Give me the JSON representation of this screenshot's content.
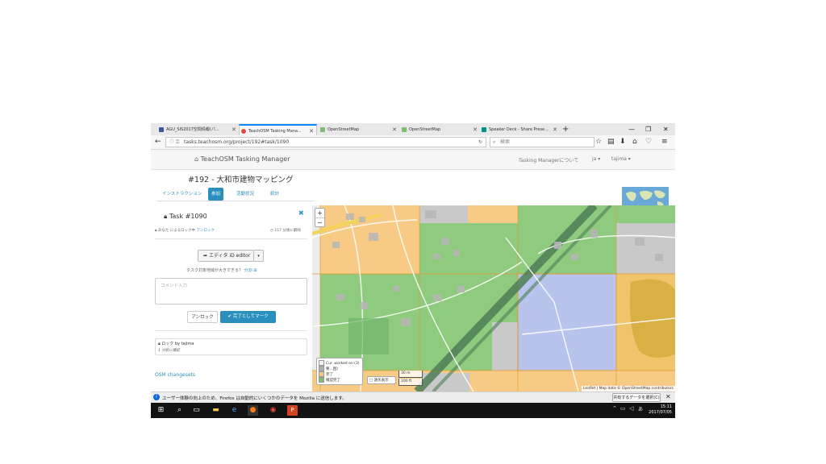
{
  "browser": {
    "tabs": [
      {
        "label": "AGU_SIS2017空間情報(パ...",
        "active": false,
        "favicon_color": "#3b5998"
      },
      {
        "label": "TeachOSM Tasking Mana...",
        "active": true,
        "favicon_color": "#e14b3b"
      },
      {
        "label": "OpenStreetMap",
        "active": false,
        "favicon_color": "#7ebc6f"
      },
      {
        "label": "OpenStreetMap",
        "active": false,
        "favicon_color": "#7ebc6f"
      },
      {
        "label": "Speaker Deck - Share Prese...",
        "active": false,
        "favicon_color": "#009287"
      }
    ],
    "new_tab": "+",
    "url": "tasks.teachosm.org/project/192#task/1090",
    "search_placeholder": "検索"
  },
  "site": {
    "brand": "TeachOSM Tasking Manager",
    "nav_about": "Tasking Managerについて",
    "nav_lang": "ja ▾",
    "nav_user": "tajima ▾",
    "project_title": "#192 - 大和市建物マッピング",
    "tabs": [
      "インストラクション",
      "参加",
      "活動状況",
      "統計"
    ]
  },
  "task": {
    "title": "Task #1090",
    "locked_text": "あなた によるロック中",
    "unlock_link": "アンロック",
    "time_left": "117 分後に解除",
    "editor_button": "エディタ iD editor",
    "split_prompt": "タスク対象地域が大きすぎる？",
    "split_link": "分割",
    "comment_placeholder": "コメント入力",
    "unlock_button": "アンロック",
    "done_button": "✔ 完了としてマーク",
    "lock_by": "ロック by tajima",
    "lock_when": "1 分前に確認",
    "osm_changesets": "OSM changesets"
  },
  "map": {
    "legend": [
      {
        "label": "Cur. worked on (3)",
        "color": "#f2f2f2"
      },
      {
        "label": "要...困)",
        "color": "#b0b0b0"
      },
      {
        "label": "完了",
        "color": "#f6c87e"
      },
      {
        "label": "確認完了",
        "color": "#7bbf6a"
      }
    ],
    "tool": "▢ 遠矢表示",
    "scale_m": "30 m",
    "scale_ft": "100 ft",
    "attribution": "Leaflet | Map data © OpenStreetMap contributors",
    "zoom_in": "+",
    "zoom_out": "−"
  },
  "notification": {
    "text": "ユーザー体験の向上のため、Firefox は自動的にいくつかのデータを Mozilla に送信します。",
    "button": "共有するデータを選択(C)"
  },
  "taskbar": {
    "time": "15:11",
    "date": "2017/07/05"
  }
}
